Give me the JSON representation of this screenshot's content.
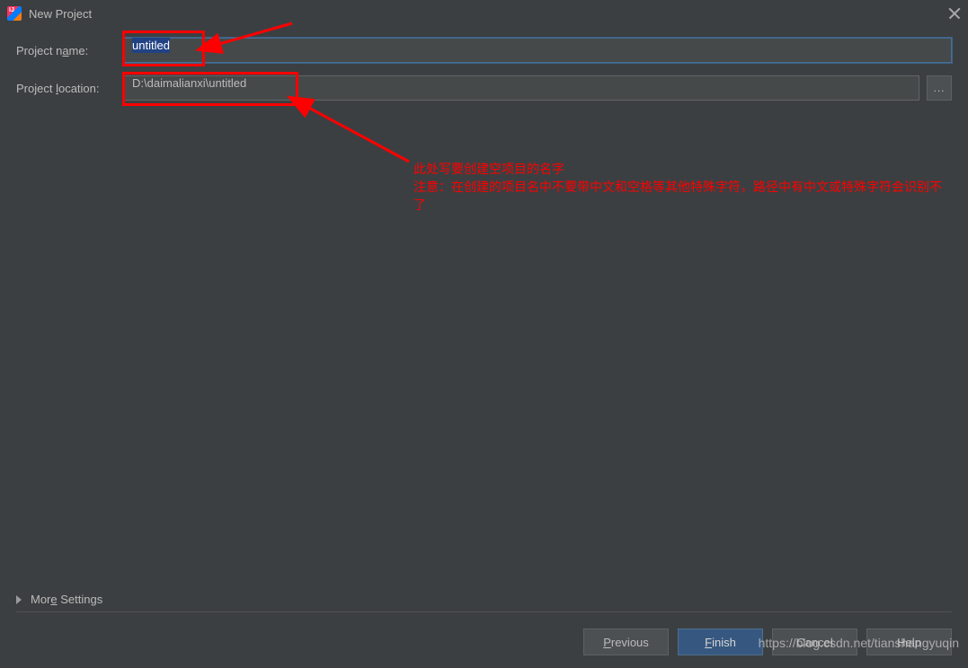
{
  "window": {
    "title": "New Project"
  },
  "form": {
    "project_name_label_pre": "Project n",
    "project_name_label_mn": "a",
    "project_name_label_post": "me:",
    "project_name_value": "untitled",
    "project_location_label_pre": "Project ",
    "project_location_label_mn": "l",
    "project_location_label_post": "ocation:",
    "project_location_value": "D:\\daimalianxi\\untitled",
    "browse_label": "..."
  },
  "more": {
    "label_pre": "Mor",
    "label_mn": "e",
    "label_post": " Settings"
  },
  "buttons": {
    "previous_mn": "P",
    "previous_post": "revious",
    "finish_mn": "F",
    "finish_post": "inish",
    "cancel": "Cancel",
    "help": "Help"
  },
  "annotation": {
    "line1": "此处写要创建空项目的名字",
    "line2": "注意：在创建的项目名中不要带中文和空格等其他特殊字符，路径中有中文或特殊字符会识别不了"
  },
  "watermark": "https://blog.csdn.net/tianshangyuqin"
}
